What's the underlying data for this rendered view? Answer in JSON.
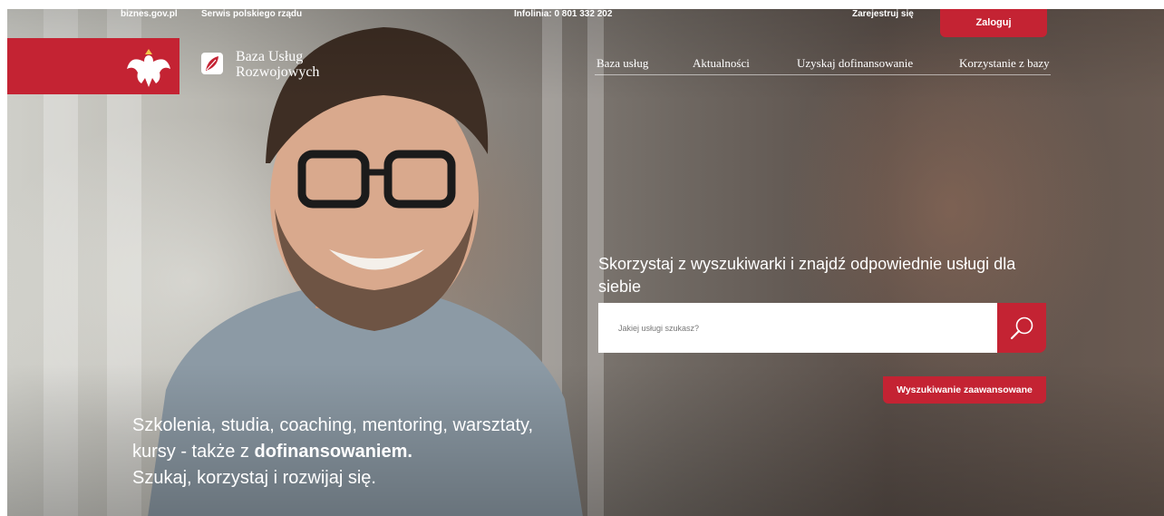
{
  "colors": {
    "brand_red": "#c42333",
    "white": "#ffffff"
  },
  "topbar": {
    "biznes": "biznes.gov.pl",
    "serwis": "Serwis polskiego rządu",
    "infolinia": "Infolinia: 0 801 332 202",
    "register": "Zarejestruj się",
    "login": "Zaloguj"
  },
  "logo": {
    "emblem_icon": "polish-eagle-icon",
    "bur_icon": "leaf-icon",
    "bur_line1": "Baza Usług",
    "bur_line2": "Rozwojowych"
  },
  "nav": {
    "items": [
      "Baza usług",
      "Aktualności",
      "Uzyskaj dofinansowanie",
      "Korzystanie z bazy"
    ]
  },
  "search": {
    "title": "Skorzystaj z wyszukiwarki i znajdź odpowiednie usługi dla siebie",
    "placeholder": "Jakiej usługi szukasz?",
    "button_icon": "search-icon",
    "advanced": "Wyszukiwanie zaawansowane"
  },
  "hero": {
    "line1": "Szkolenia, studia, coaching, mentoring, warsztaty,",
    "line2_pre": "kursy - także z ",
    "line2_bold": "dofinansowaniem.",
    "line3": "Szukaj, korzystaj i rozwijaj się."
  }
}
